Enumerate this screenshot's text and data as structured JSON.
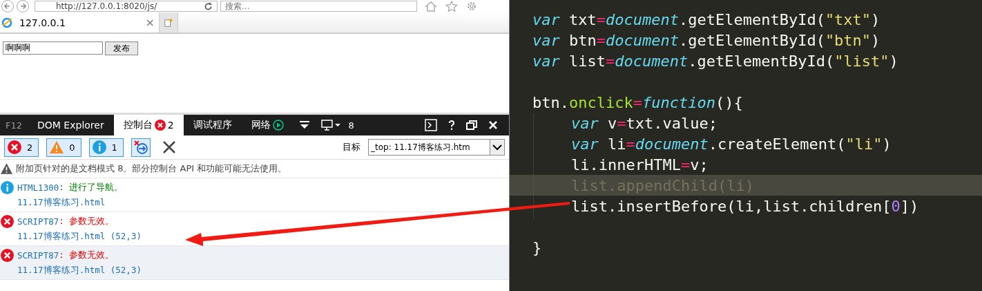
{
  "browser": {
    "address": "http://127.0.0.1:8020/js/",
    "search_placeholder": "搜索...",
    "tabs": [
      {
        "title": "127.0.0.1",
        "close": "×",
        "selected": true
      }
    ],
    "page": {
      "input_value": "啊啊啊",
      "button": "发布"
    }
  },
  "devtools": {
    "brand": "F12",
    "tabs": [
      {
        "label": "DOM Explorer",
        "selected": false,
        "kind": "plain"
      },
      {
        "label": "控制台",
        "selected": true,
        "kind": "errors",
        "badge": "2"
      },
      {
        "label": "调试程序",
        "selected": false,
        "kind": "plain"
      },
      {
        "label": "网络",
        "selected": false,
        "kind": "play"
      }
    ],
    "emulation": "8",
    "filters": [
      {
        "kind": "error",
        "count": "2",
        "selected": true
      },
      {
        "kind": "warning",
        "count": "0",
        "selected": true
      },
      {
        "kind": "info",
        "count": "1",
        "selected": true
      }
    ],
    "target_label": "目标",
    "target_value": "_top: 11.17博客练习.htm",
    "messages": [
      {
        "kind": "warning",
        "text": "附加页针对的是文档模式 8。部分控制台 API 和功能可能无法使用。",
        "selected": false
      },
      {
        "kind": "info",
        "code": "HTML1300",
        "text": ": 进行了导航。",
        "source": "11.17博客练习.html",
        "selected": false
      },
      {
        "kind": "error",
        "code": "SCRIPT87",
        "text": ": 参数无效。",
        "source": "11.17博客练习.html (52,3)",
        "selected": false
      },
      {
        "kind": "error",
        "code": "SCRIPT87",
        "text": ": 参数无效。",
        "source": "11.17博客练习.html (52,3)",
        "selected": true
      }
    ]
  },
  "editor": {
    "lines": [
      {
        "kind": "code",
        "highlighted": false,
        "tokens": [
          {
            "kind": "keyword",
            "text": "var"
          },
          {
            "kind": "plain",
            "text": " txt"
          },
          {
            "kind": "operator",
            "text": "="
          },
          {
            "kind": "builtin",
            "text": "document"
          },
          {
            "kind": "plain",
            "text": ".getElementById("
          },
          {
            "kind": "string",
            "text": "\"txt\""
          },
          {
            "kind": "plain",
            "text": ")"
          }
        ]
      },
      {
        "kind": "code",
        "highlighted": false,
        "tokens": [
          {
            "kind": "keyword",
            "text": "var"
          },
          {
            "kind": "plain",
            "text": " btn"
          },
          {
            "kind": "operator",
            "text": "="
          },
          {
            "kind": "builtin",
            "text": "document"
          },
          {
            "kind": "plain",
            "text": ".getElementById("
          },
          {
            "kind": "string",
            "text": "\"btn\""
          },
          {
            "kind": "plain",
            "text": ")"
          }
        ]
      },
      {
        "kind": "code",
        "highlighted": false,
        "tokens": [
          {
            "kind": "keyword",
            "text": "var"
          },
          {
            "kind": "plain",
            "text": " list"
          },
          {
            "kind": "operator",
            "text": "="
          },
          {
            "kind": "builtin",
            "text": "document"
          },
          {
            "kind": "plain",
            "text": ".getElementById("
          },
          {
            "kind": "string",
            "text": "\"list\""
          },
          {
            "kind": "plain",
            "text": ")"
          }
        ]
      },
      {
        "kind": "blank"
      },
      {
        "kind": "code",
        "highlighted": false,
        "tokens": [
          {
            "kind": "plain",
            "text": "btn."
          },
          {
            "kind": "property",
            "text": "onclick"
          },
          {
            "kind": "operator",
            "text": "="
          },
          {
            "kind": "keyword",
            "text": "function"
          },
          {
            "kind": "plain",
            "text": "(){"
          }
        ],
        "children": [
          {
            "kind": "code",
            "highlighted": false,
            "tokens": [
              {
                "kind": "keyword",
                "text": "var"
              },
              {
                "kind": "plain",
                "text": " v"
              },
              {
                "kind": "operator",
                "text": "="
              },
              {
                "kind": "plain",
                "text": "txt.value;"
              }
            ]
          },
          {
            "kind": "code",
            "highlighted": false,
            "tokens": [
              {
                "kind": "keyword",
                "text": "var"
              },
              {
                "kind": "plain",
                "text": " li"
              },
              {
                "kind": "operator",
                "text": "="
              },
              {
                "kind": "builtin",
                "text": "document"
              },
              {
                "kind": "plain",
                "text": ".createElement("
              },
              {
                "kind": "string",
                "text": "\"li\""
              },
              {
                "kind": "plain",
                "text": ")"
              }
            ]
          },
          {
            "kind": "code",
            "highlighted": false,
            "tokens": [
              {
                "kind": "plain",
                "text": "li.innerHTML"
              },
              {
                "kind": "operator",
                "text": "="
              },
              {
                "kind": "plain",
                "text": "v;"
              }
            ]
          },
          {
            "kind": "code",
            "highlighted": true,
            "tokens": [
              {
                "kind": "plain",
                "text": "list.appendChild(li)"
              }
            ]
          },
          {
            "kind": "code",
            "highlighted": false,
            "tokens": [
              {
                "kind": "plain",
                "text": "list.insertBefore(li,list.children["
              },
              {
                "kind": "number",
                "text": "0"
              },
              {
                "kind": "plain",
                "text": "])"
              }
            ]
          },
          {
            "kind": "blank"
          }
        ]
      },
      {
        "kind": "code",
        "highlighted": false,
        "tokens": [
          {
            "kind": "plain",
            "text": "}"
          }
        ]
      }
    ]
  }
}
